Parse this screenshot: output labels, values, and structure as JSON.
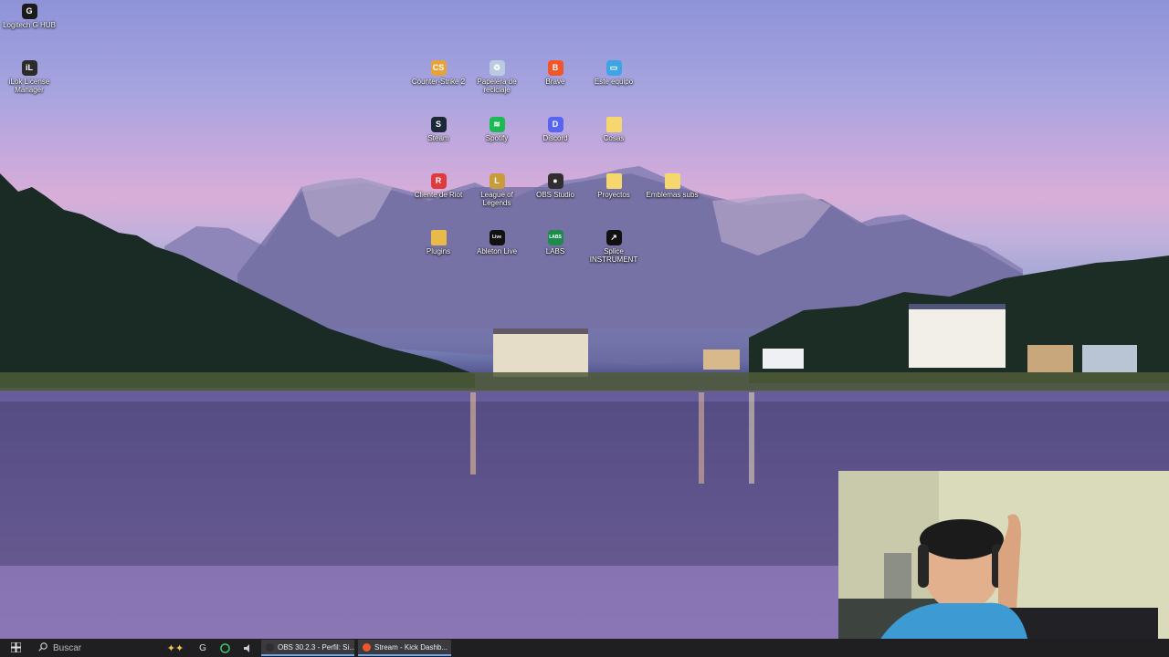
{
  "desktop": {
    "icons": [
      {
        "label": "Logitech G HUB",
        "icon": "logitech-ghub-icon",
        "color": "#1b1b1b",
        "glyph": "G"
      },
      {
        "label": "iLok License Manager",
        "icon": "ilok-icon",
        "color": "#2b2b2b",
        "glyph": "iL"
      },
      {
        "label": "Counter-Strike 2",
        "icon": "counter-strike-icon",
        "color": "#e7a33a",
        "glyph": "CS"
      },
      {
        "label": "Papelera de reciclaje",
        "icon": "recycle-bin-icon",
        "color": "#b9cbe0",
        "glyph": "♻"
      },
      {
        "label": "Brave",
        "icon": "brave-icon",
        "color": "#f1552a",
        "glyph": "B"
      },
      {
        "label": "Este equipo",
        "icon": "this-pc-icon",
        "color": "#3ea4e6",
        "glyph": "▭"
      },
      {
        "label": "Steam",
        "icon": "steam-icon",
        "color": "#1b2838",
        "glyph": "S"
      },
      {
        "label": "Spotify",
        "icon": "spotify-icon",
        "color": "#1db954",
        "glyph": "≋"
      },
      {
        "label": "Discord",
        "icon": "discord-icon",
        "color": "#5865f2",
        "glyph": "D"
      },
      {
        "label": "Cosas",
        "icon": "folder-icon",
        "color": "#f5d76e",
        "glyph": ""
      },
      {
        "label": "Cliente de Riot",
        "icon": "riot-client-icon",
        "color": "#e03a3e",
        "glyph": "R"
      },
      {
        "label": "League of Legends",
        "icon": "league-of-legends-icon",
        "color": "#c89b3c",
        "glyph": "L"
      },
      {
        "label": "OBS Studio",
        "icon": "obs-studio-icon",
        "color": "#302e31",
        "glyph": "●"
      },
      {
        "label": "Proyectos",
        "icon": "folder-icon",
        "color": "#f5d76e",
        "glyph": ""
      },
      {
        "label": "Emblemas subs",
        "icon": "folder-icon",
        "color": "#f5d76e",
        "glyph": ""
      },
      {
        "label": "Plugins",
        "icon": "folder-icon",
        "color": "#e9b949",
        "glyph": ""
      },
      {
        "label": "Ableton Live",
        "icon": "ableton-live-icon",
        "color": "#111111",
        "glyph": "Live"
      },
      {
        "label": "LABS",
        "icon": "labs-icon",
        "color": "#1d8a4e",
        "glyph": "LABS"
      },
      {
        "label": "Splice INSTRUMENT",
        "icon": "splice-instrument-icon",
        "color": "#111111",
        "glyph": "↗"
      }
    ]
  },
  "taskbar": {
    "start_icon": "windows-start-icon",
    "search_placeholder": "Buscar",
    "windows": [
      {
        "label": "OBS 30.2.3 - Perfil: Si...",
        "icon": "obs-studio-icon",
        "color": "#302e31"
      },
      {
        "label": "Stream - Kick Dashb...",
        "icon": "brave-icon",
        "color": "#f1552a"
      }
    ]
  },
  "webcam": {
    "description_icon": "webcam-overlay"
  }
}
